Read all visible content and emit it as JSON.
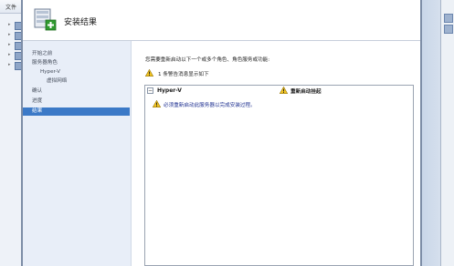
{
  "background_window": {
    "menu_label": "文件"
  },
  "wizard": {
    "title": "安装结果",
    "nav": [
      {
        "label": "开始之前",
        "active": false
      },
      {
        "label": "服务器角色",
        "active": false
      },
      {
        "label": "Hyper-V",
        "active": false
      },
      {
        "label": "虚拟网络",
        "active": false
      },
      {
        "label": "确认",
        "active": false
      },
      {
        "label": "进度",
        "active": false
      },
      {
        "label": "结果",
        "active": true
      }
    ],
    "content": {
      "intro": "您需要重新启动以下一个或多个角色、角色服务或功能:",
      "warning_summary": "1 条警告消息显示如下",
      "result": {
        "role": "Hyper-V",
        "collapse_symbol": "−",
        "status": "重新启动挂起",
        "message": "必须重新启动此服务器以完成安装过程。"
      }
    }
  },
  "colors": {
    "nav_bg": "#e8eef8",
    "nav_active": "#3b79c7",
    "message_text": "#1b2d8f",
    "warning_yellow": "#f3c522"
  }
}
